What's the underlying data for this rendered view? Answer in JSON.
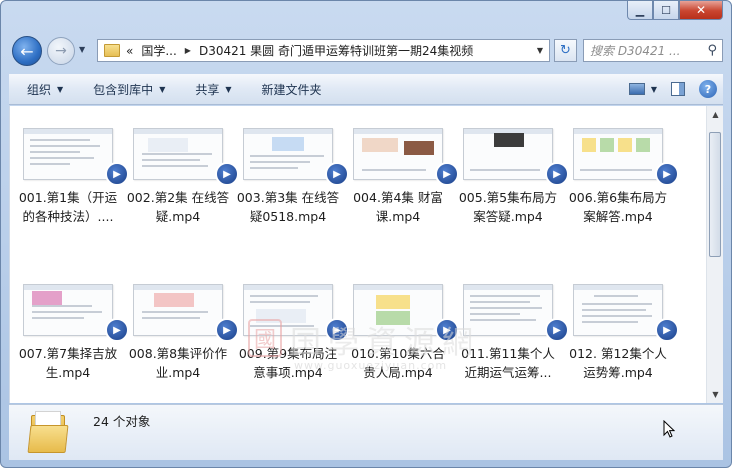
{
  "window": {
    "caption_buttons": [
      {
        "name": "minimize-button",
        "glyph": "▁"
      },
      {
        "name": "maximize-button",
        "glyph": "☐"
      },
      {
        "name": "close-button",
        "glyph": "✕"
      }
    ]
  },
  "address": {
    "overflow_marker": "«",
    "crumbs": [
      "国学...",
      "D30421 果圆 奇门遁甲运筹特训班第一期24集视频"
    ]
  },
  "search": {
    "placeholder": "搜索 D30421 ..."
  },
  "toolbar": {
    "organize": "组织",
    "include_in_library": "包含到库中",
    "share": "共享",
    "new_folder": "新建文件夹"
  },
  "files": [
    {
      "line1": "001.第1集（开运",
      "line2": "的各种技法）...."
    },
    {
      "line1": "002.第2集 在线答",
      "line2": "疑.mp4"
    },
    {
      "line1": "003.第3集 在线答",
      "line2": "疑0518.mp4"
    },
    {
      "line1": "004.第4集  财富",
      "line2": "课.mp4"
    },
    {
      "line1": "005.第5集布局方",
      "line2": "案答疑.mp4"
    },
    {
      "line1": "006.第6集布局方",
      "line2": "案解答.mp4"
    },
    {
      "line1": "007.第7集择吉放",
      "line2": "生.mp4"
    },
    {
      "line1": "008.第8集评价作",
      "line2": "业.mp4"
    },
    {
      "line1": "009.第9集布局注",
      "line2": "意事项.mp4"
    },
    {
      "line1": "010.第10集六合",
      "line2": "贵人局.mp4"
    },
    {
      "line1": "011.第11集个人",
      "line2": "近期运气运筹..."
    },
    {
      "line1": "012. 第12集个人",
      "line2": "运势筹.mp4"
    }
  ],
  "status": {
    "count_text": "24 个对象"
  },
  "watermark": {
    "seal": "國",
    "text": "国學資源網",
    "url": "www.guoxueziyuan.com"
  },
  "colors": {
    "accent": "#2e6fc4",
    "badge": "#1a3f87",
    "close": "#c9452f"
  }
}
